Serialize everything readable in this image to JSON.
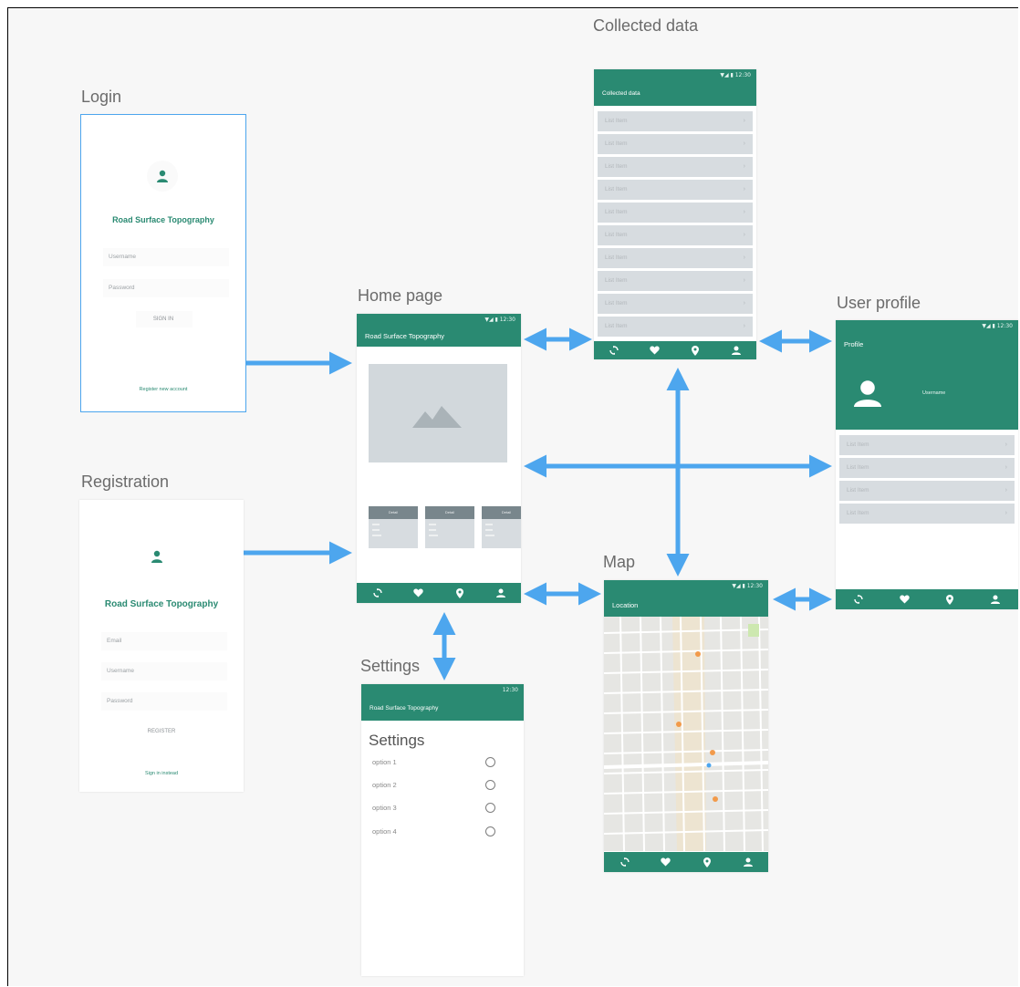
{
  "colors": {
    "primary": "#2a8a72",
    "arrow": "#4da6ee",
    "placeholder": "#d7dce0"
  },
  "screens": {
    "login": {
      "title": "Login",
      "app_name": "Road Surface Topography",
      "username_placeholder": "Username",
      "password_placeholder": "Password",
      "sign_in_label": "SIGN IN",
      "register_link": "Register new account"
    },
    "registration": {
      "title": "Registration",
      "app_name": "Road Surface Topography",
      "email_placeholder": "Email",
      "username_placeholder": "Username",
      "password_placeholder": "Password",
      "register_label": "REGISTER",
      "sign_in_link": "Sign in instead"
    },
    "home": {
      "title": "Home page",
      "status": "▼◢ ▮ 12:30",
      "appbar_title": "Road Surface Topography",
      "cards": [
        {
          "label": "Detail"
        },
        {
          "label": "Detail"
        },
        {
          "label": "Detail"
        }
      ]
    },
    "collected": {
      "title": "Collected data",
      "status": "▼◢ ▮ 12:30",
      "appbar_title": "Collected data",
      "items": [
        "List Item",
        "List Item",
        "List Item",
        "List Item",
        "List Item",
        "List Item",
        "List Item",
        "List Item",
        "List Item",
        "List Item"
      ]
    },
    "profile": {
      "title": "User profile",
      "status": "▼◢ ▮ 12:30",
      "appbar_title": "Profile",
      "username": "Username",
      "items": [
        "List Item",
        "List Item",
        "List Item",
        "List Item"
      ]
    },
    "settings": {
      "title": "Settings",
      "status": "12:30",
      "appbar_title": "Road Surface Topography",
      "heading": "Settings",
      "options": [
        "option 1",
        "option 2",
        "option 3",
        "option 4"
      ]
    },
    "map": {
      "title": "Map",
      "status": "▼◢ ▮ 12:30",
      "appbar_title": "Location"
    }
  },
  "bottom_nav_icons": [
    "sync-icon",
    "heart-icon",
    "location-pin-icon",
    "person-icon"
  ]
}
